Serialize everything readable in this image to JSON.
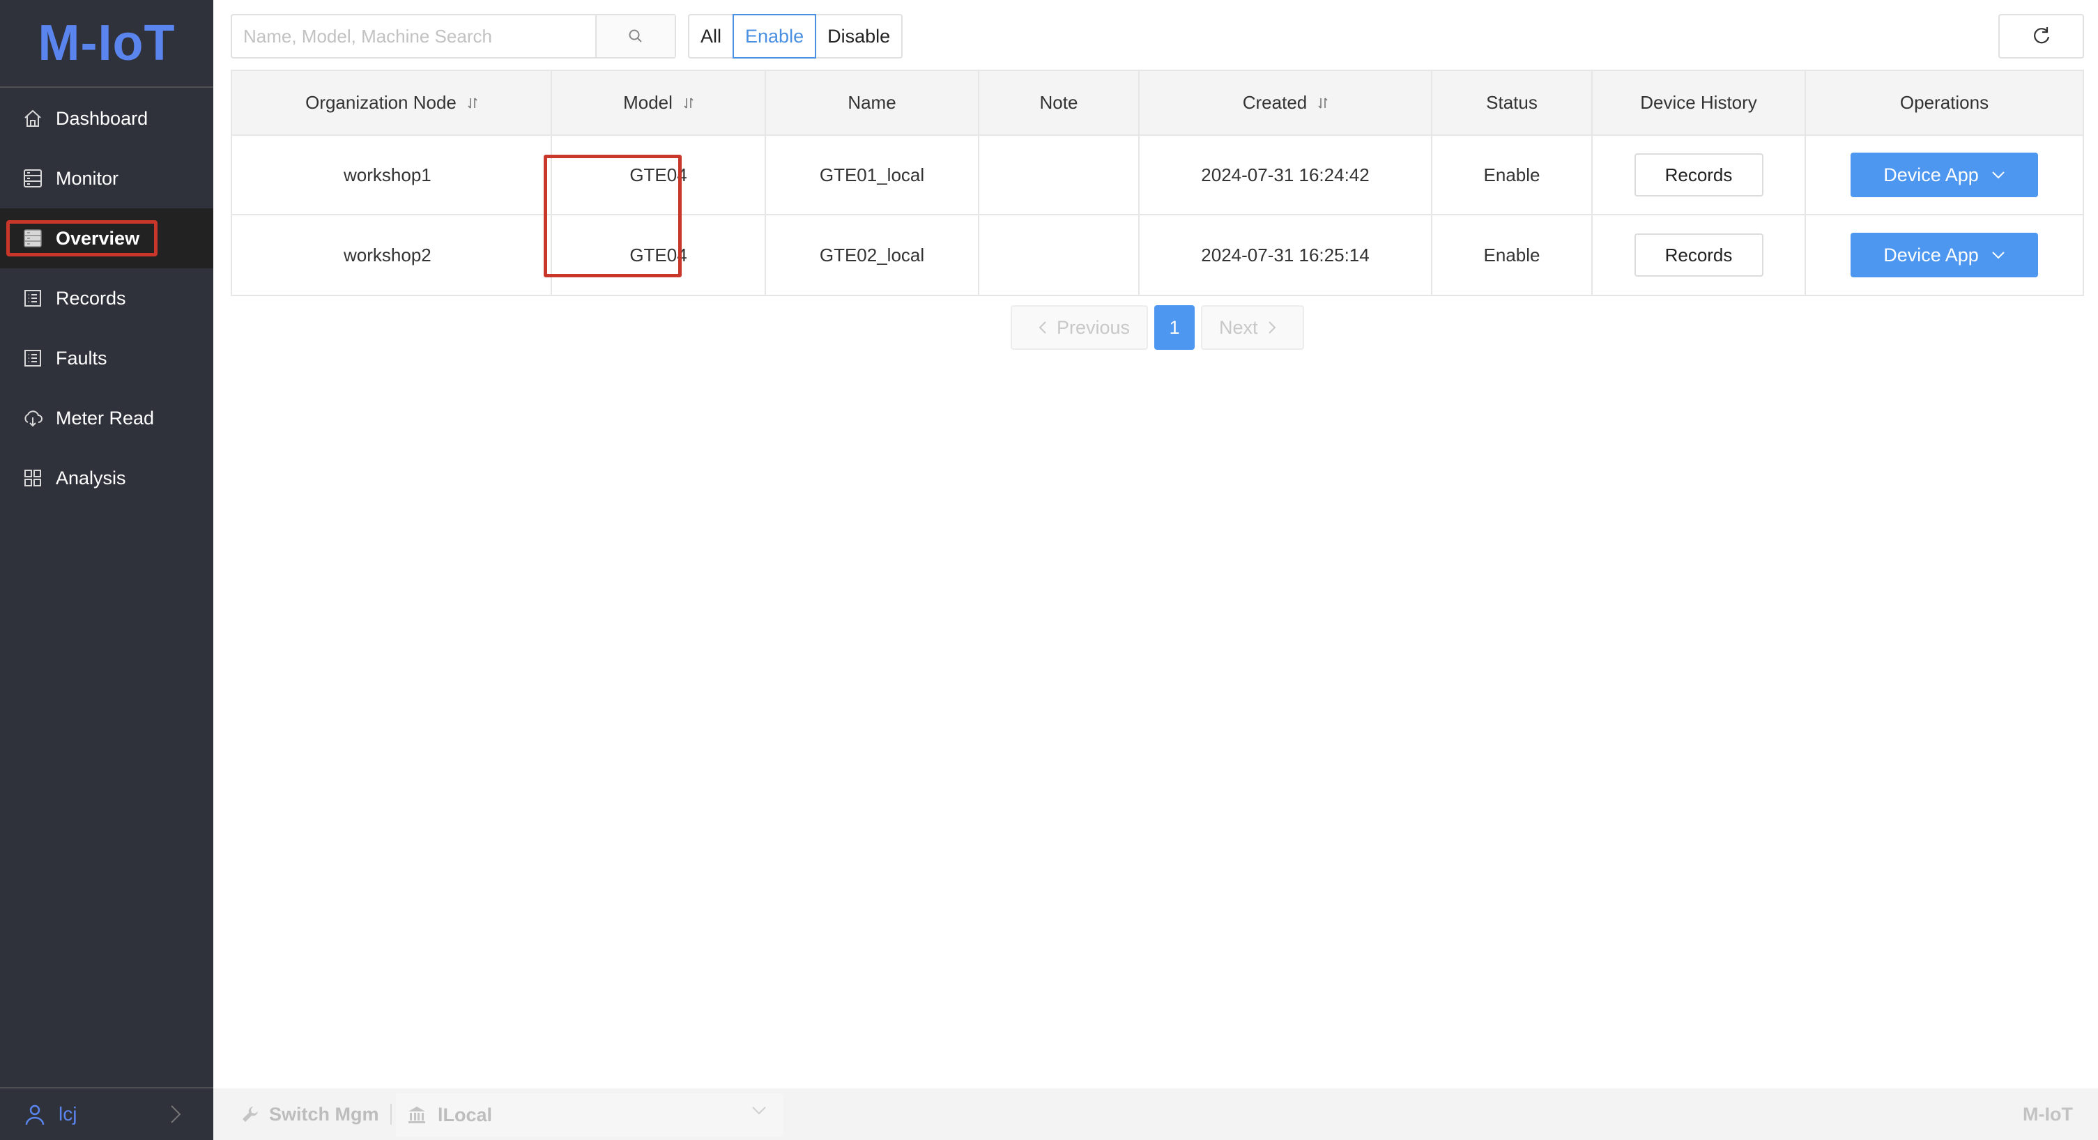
{
  "app": {
    "logo": "M-IoT",
    "brand_color": "#5b85ee",
    "accent_color": "#4d97f0",
    "highlight_color": "#c8372a"
  },
  "sidebar": {
    "items": [
      {
        "label": "Dashboard",
        "icon": "home-icon"
      },
      {
        "label": "Monitor",
        "icon": "server-icon"
      },
      {
        "label": "Overview",
        "icon": "server-icon",
        "active": true
      },
      {
        "label": "Records",
        "icon": "list-icon"
      },
      {
        "label": "Faults",
        "icon": "list-icon"
      },
      {
        "label": "Meter Read",
        "icon": "cloud-download-icon"
      },
      {
        "label": "Analysis",
        "icon": "grid-icon"
      }
    ],
    "user": {
      "name": "lcj",
      "icon": "user-icon"
    }
  },
  "toolbar": {
    "search_placeholder": "Name, Model, Machine Search",
    "search_value": "",
    "filter": {
      "options": [
        "All",
        "Enable",
        "Disable"
      ],
      "selected": "Enable"
    },
    "refresh_icon": "refresh-icon"
  },
  "table": {
    "columns": [
      {
        "label": "Organization Node",
        "sortable": true
      },
      {
        "label": "Model",
        "sortable": true
      },
      {
        "label": "Name",
        "sortable": false
      },
      {
        "label": "Note",
        "sortable": false
      },
      {
        "label": "Created",
        "sortable": true
      },
      {
        "label": "Status",
        "sortable": false
      },
      {
        "label": "Device History",
        "sortable": false
      },
      {
        "label": "Operations",
        "sortable": false
      }
    ],
    "rows": [
      {
        "org": "workshop1",
        "model": "GTE04",
        "name": "GTE01_local",
        "note": "",
        "created": "2024-07-31 16:24:42",
        "status": "Enable",
        "history_btn": "Records",
        "op_btn": "Device App"
      },
      {
        "org": "workshop2",
        "model": "GTE04",
        "name": "GTE02_local",
        "note": "",
        "created": "2024-07-31 16:25:14",
        "status": "Enable",
        "history_btn": "Records",
        "op_btn": "Device App"
      }
    ]
  },
  "pagination": {
    "previous": "Previous",
    "next": "Next",
    "current_page": "1"
  },
  "footer": {
    "switch_label": "Switch Mgm",
    "org_value": "lLocal",
    "brand": "M-IoT"
  }
}
